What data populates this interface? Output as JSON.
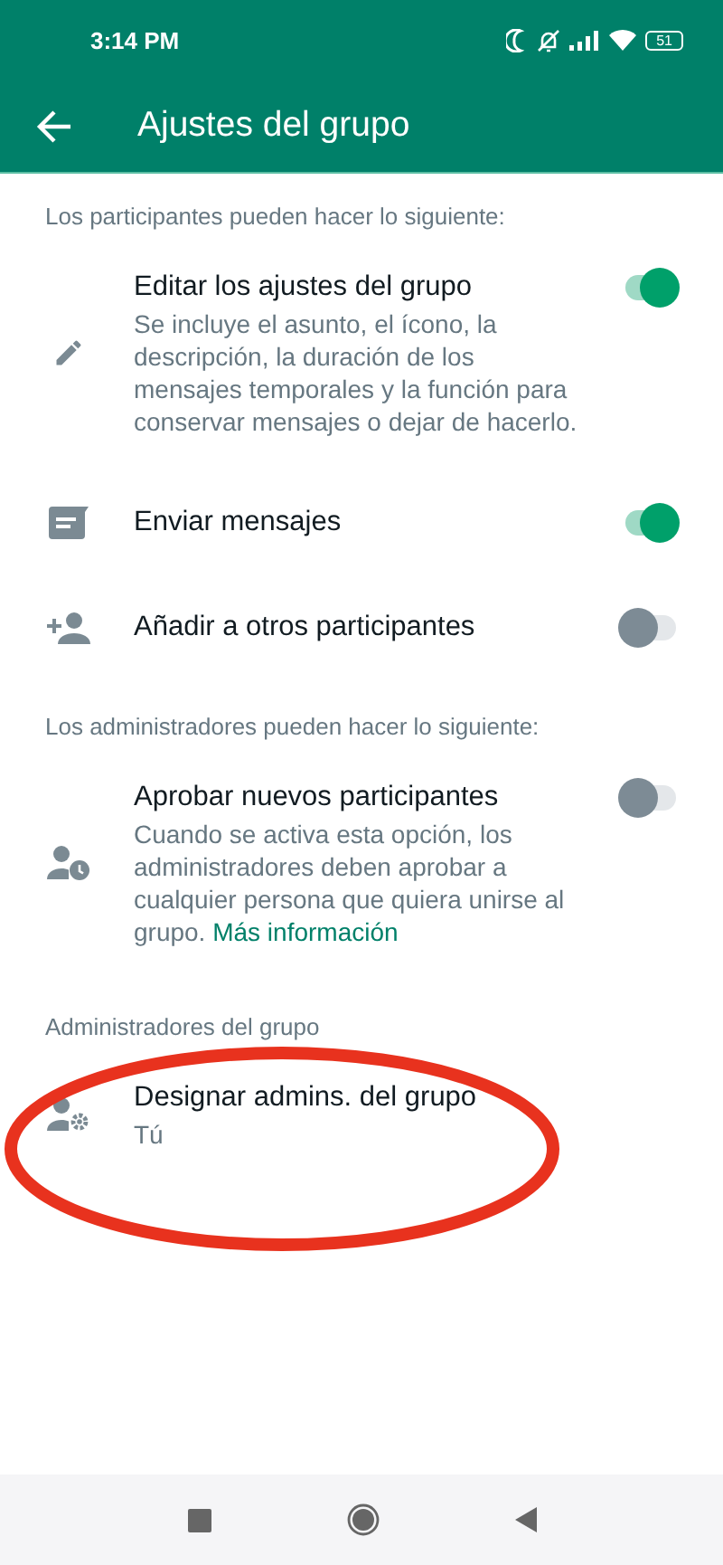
{
  "status_bar": {
    "time": "3:14 PM",
    "battery": "51"
  },
  "app_bar": {
    "title": "Ajustes del grupo"
  },
  "sections": [
    {
      "header": "Los participantes pueden hacer lo siguiente:",
      "items": [
        {
          "kind": "pencil",
          "title": "Editar los ajustes del grupo",
          "description": "Se incluye el asunto, el ícono, la descripción, la duración de los mensajes temporales y la función para conservar mensajes o dejar de hacerlo.",
          "on": true
        },
        {
          "kind": "message",
          "title": "Enviar mensajes",
          "on": true
        },
        {
          "kind": "add-person",
          "title": "Añadir a otros participantes",
          "on": false
        }
      ]
    },
    {
      "header": "Los administradores pueden hacer lo siguiente:",
      "items": [
        {
          "kind": "person-clock",
          "title": "Aprobar nuevos participantes",
          "description": "Cuando se activa esta opción, los administradores deben aprobar a cualquier persona que quiera unirse al grupo.",
          "link": "Más información",
          "on": false
        }
      ]
    },
    {
      "header": "Administradores del grupo",
      "items": [
        {
          "kind": "person-gear",
          "title": "Designar admins. del grupo",
          "subtitle": "Tú"
        }
      ]
    }
  ]
}
